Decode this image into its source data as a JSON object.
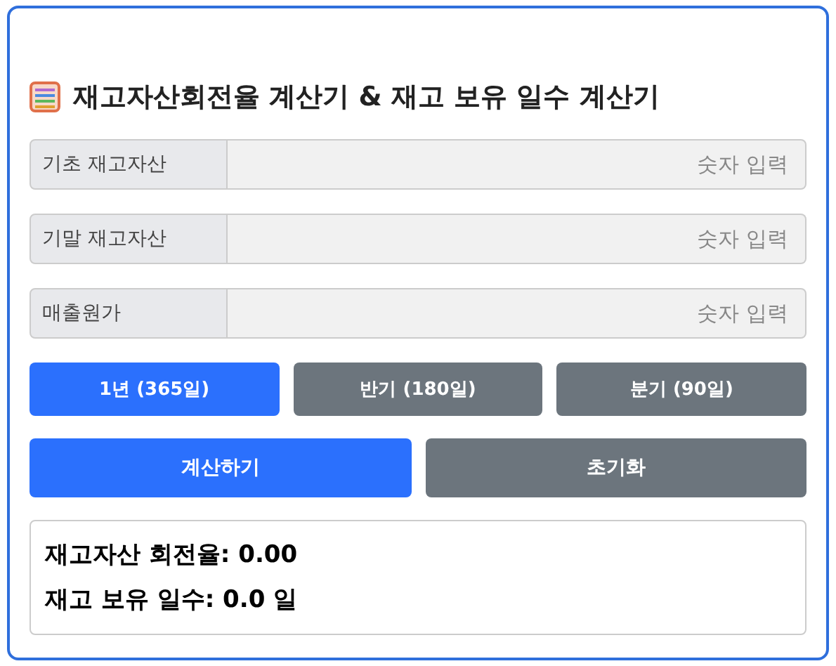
{
  "title": "재고자산회전율 계산기 & 재고 보유 일수 계산기",
  "fields": [
    {
      "label": "기초 재고자산",
      "placeholder": "숫자 입력"
    },
    {
      "label": "기말 재고자산",
      "placeholder": "숫자 입력"
    },
    {
      "label": "매출원가",
      "placeholder": "숫자 입력"
    }
  ],
  "periods": [
    {
      "label": "1년 (365일)",
      "selected": true
    },
    {
      "label": "반기 (180일)",
      "selected": false
    },
    {
      "label": "분기 (90일)",
      "selected": false
    }
  ],
  "actions": [
    {
      "label": "계산하기",
      "kind": "primary"
    },
    {
      "label": "초기화",
      "kind": "secondary"
    }
  ],
  "results": [
    "재고자산 회전율: 0.00",
    "재고 보유 일수: 0.0 일"
  ]
}
